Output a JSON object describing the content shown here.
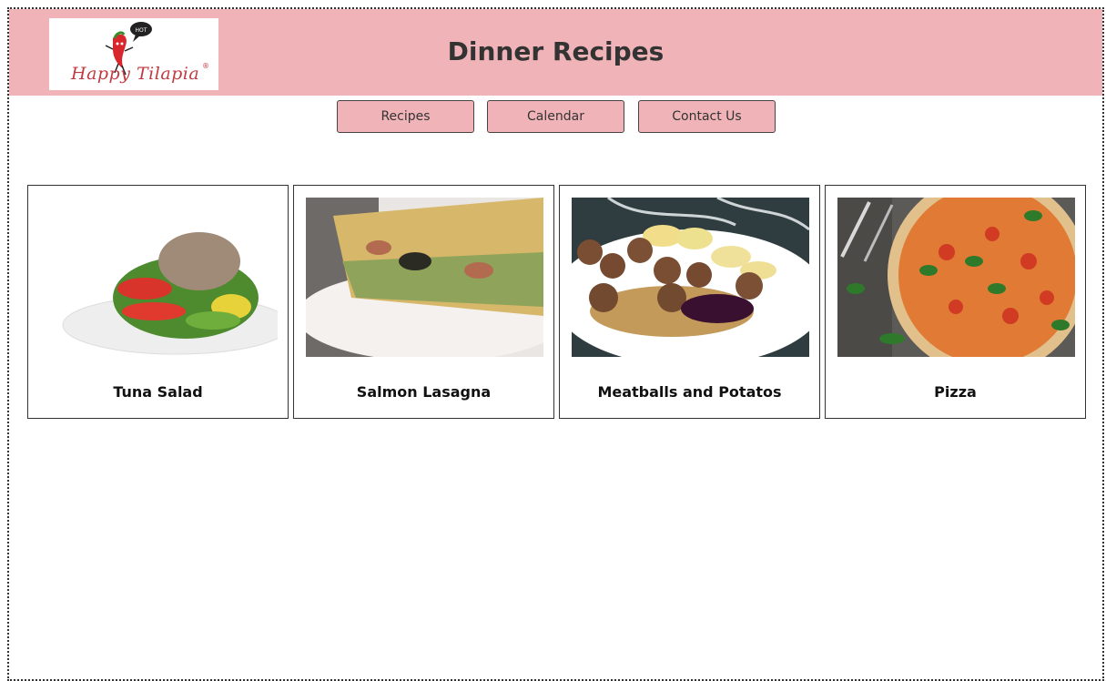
{
  "header": {
    "title": "Dinner Recipes",
    "logo_text": "Happy Tilapia",
    "logo_reg": "®",
    "logo_badge": "HOT",
    "background": "#f0b4b8"
  },
  "nav": [
    {
      "label": "Recipes"
    },
    {
      "label": "Calendar"
    },
    {
      "label": "Contact Us"
    }
  ],
  "recipes": [
    {
      "name": "Tuna Salad"
    },
    {
      "name": "Salmon Lasagna"
    },
    {
      "name": "Meatballs and Potatos"
    },
    {
      "name": "Pizza"
    }
  ]
}
